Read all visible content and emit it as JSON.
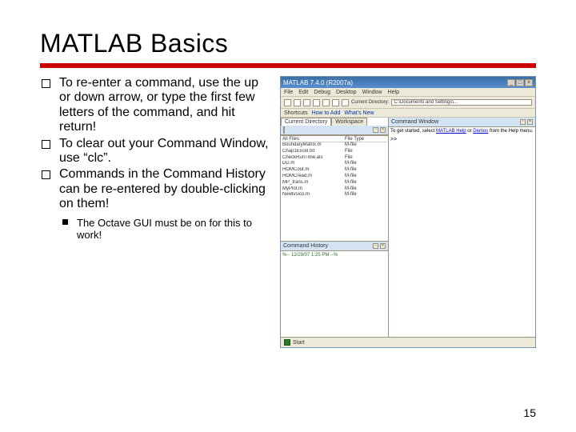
{
  "title": "MATLAB Basics",
  "bullets": [
    "To re-enter a command, use the up or down arrow, or type the first few letters of the command, and hit return!",
    "To clear out your Command Window, use “clc”.",
    "Commands in the Command History can be re-entered by double-clicking on them!"
  ],
  "subbullet": "The Octave GUI must be on for this to work!",
  "page_number": "15",
  "matlab": {
    "title": "MATLAB 7.4.0 (R2007a)",
    "winbtns": {
      "min": "_",
      "max": "□",
      "close": "×"
    },
    "menu": [
      "File",
      "Edit",
      "Debug",
      "Desktop",
      "Window",
      "Help"
    ],
    "toolbar_dir_label": "Current Directory:",
    "toolbar_dir_value": "C:\\Documents and Settings\\...",
    "shortcuts": [
      "Shortcuts",
      "How to Add",
      "What's New"
    ],
    "curdir": {
      "tab1": "Current Directory",
      "tab2": "Workspace",
      "cols": [
        "All Files",
        "File Type"
      ],
      "rows": [
        [
          "BoundaryMatrix.m",
          "M-file"
        ],
        [
          "Chap1Excel.txt",
          "File"
        ],
        [
          "CheckRunTime.als",
          "File"
        ],
        [
          "DD.m",
          "M-file"
        ],
        [
          "HOMCout.m",
          "M-file"
        ],
        [
          "HOMCread.m",
          "M-file"
        ],
        [
          "MP_trans.m",
          "M-file"
        ],
        [
          "MyPlot.m",
          "M-file"
        ],
        [
          "Newtvsico.m",
          "M-file"
        ]
      ]
    },
    "history": {
      "title": "Command History",
      "entry": "%-- 12/29/07  1:25 PM --%"
    },
    "cmdwin": {
      "title": "Command Window",
      "info_pre": "To get started, select ",
      "info_link1": "MATLAB Help",
      "info_mid": " or ",
      "info_link2": "Demos",
      "info_post": " from the Help menu.",
      "prompt": ">>"
    },
    "status": "Start"
  }
}
